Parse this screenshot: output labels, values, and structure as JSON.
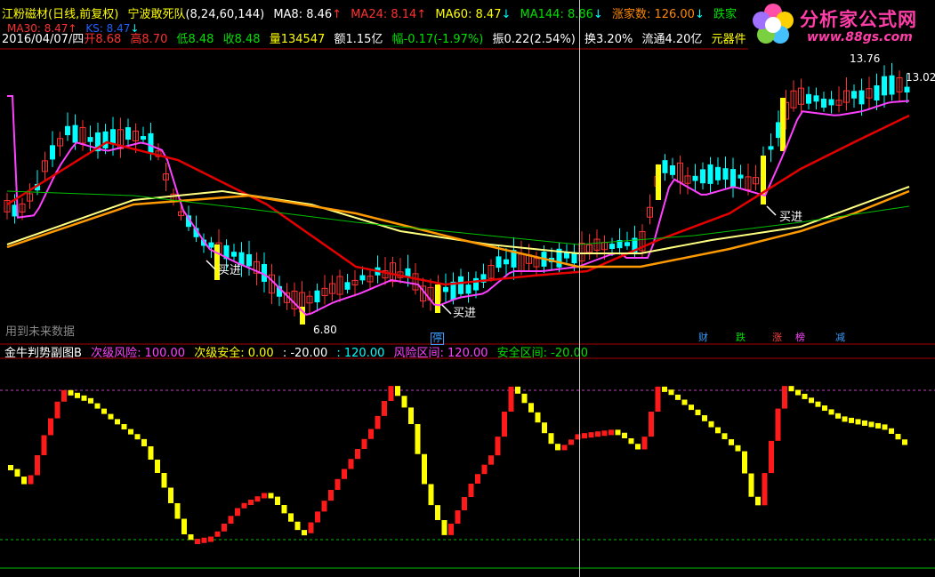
{
  "header": {
    "stock_name": "江粉磁材",
    "period_info": "(日线,前复权)",
    "formula_name": "宁波敢死队",
    "formula_params": "(8,24,60,144)",
    "ma8": "MA8: 8.46",
    "ma24": "MA24: 8.14",
    "ma60": "MA60: 8.47",
    "ma144": "MA144: 8.86",
    "rise_label": "涨家数: 126.00",
    "fall_label": "跌家",
    "arrow_down": "↓",
    "arrow_up": "↑"
  },
  "quote": {
    "date": "2016/04/07/四",
    "open": "开8.68",
    "high": "高8.70",
    "low": "低8.48",
    "close": "收8.48",
    "volume": "量134547",
    "amount": "额1.15亿",
    "change": "幅-0.17(-1.97%)",
    "amplitude": "振0.22(2.54%)",
    "turnover": "换3.20%",
    "float": "流通4.20亿",
    "sector": "元器件"
  },
  "ma_lines": {
    "ma30": "MA30: 8.47",
    "ks": "KS: 8.47"
  },
  "main_chart": {
    "high_label": "13.76",
    "last_label": "13.02",
    "low_label": "6.80",
    "buy_label": "买进",
    "future_data_note": "用到未来数据",
    "event_tags": [
      {
        "text": "停",
        "color": "#3a9cff"
      },
      {
        "text": "财",
        "color": "#3a9cff"
      },
      {
        "text": "跌",
        "color": "#00e000"
      },
      {
        "text": "涨",
        "color": "#ff4040"
      },
      {
        "text": "榜",
        "color": "#ff40ff"
      },
      {
        "text": "减",
        "color": "#3a9cff"
      }
    ]
  },
  "sub_chart": {
    "title": "金牛判势副图B",
    "risk_label": "次级风险: 100.00",
    "safe_label": "次级安全: 0.00",
    "value_a": ": -20.00",
    "value_b": ": 120.00",
    "risk_zone": "风险区间: 120.00",
    "safe_zone": "安全区间: -20.00"
  },
  "logo": {
    "title": "分析家公式网",
    "url": "www.88gs.com"
  },
  "colors": {
    "up": "#ff3030",
    "down": "#00ffff",
    "ma8": "#ff40ff",
    "ma24": "#e60000",
    "ma60": "#ffff80",
    "ma144": "#ff9900",
    "ma_green": "#00c000"
  }
}
